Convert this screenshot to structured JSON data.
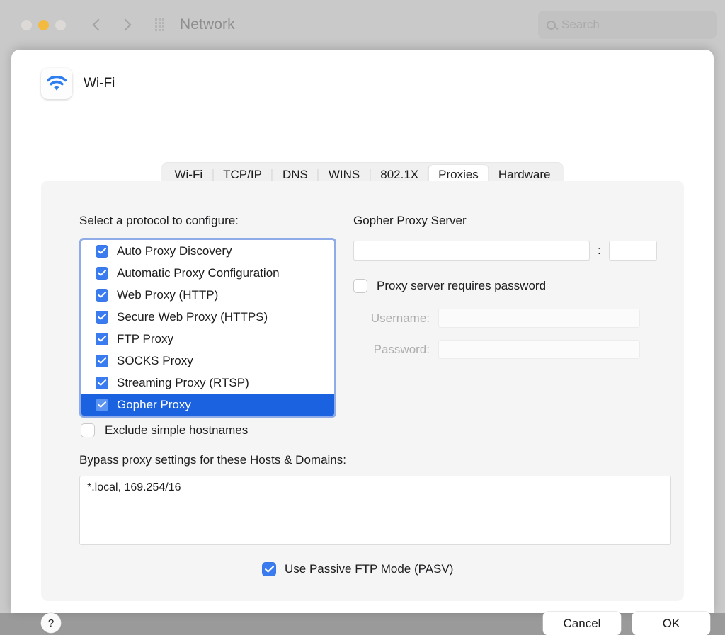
{
  "window": {
    "title": "Network",
    "search_placeholder": "Search",
    "traffic_lights": [
      "close",
      "minimize",
      "zoom"
    ]
  },
  "sheet": {
    "service_name": "Wi-Fi",
    "service_icon": "wifi-icon",
    "tabs": [
      {
        "label": "Wi-Fi",
        "selected": false
      },
      {
        "label": "TCP/IP",
        "selected": false
      },
      {
        "label": "DNS",
        "selected": false
      },
      {
        "label": "WINS",
        "selected": false
      },
      {
        "label": "802.1X",
        "selected": false
      },
      {
        "label": "Proxies",
        "selected": true
      },
      {
        "label": "Hardware",
        "selected": false
      }
    ],
    "protocol_section": {
      "label": "Select a protocol to configure:",
      "items": [
        {
          "label": "Auto Proxy Discovery",
          "checked": true,
          "selected": false
        },
        {
          "label": "Automatic Proxy Configuration",
          "checked": true,
          "selected": false
        },
        {
          "label": "Web Proxy (HTTP)",
          "checked": true,
          "selected": false
        },
        {
          "label": "Secure Web Proxy (HTTPS)",
          "checked": true,
          "selected": false
        },
        {
          "label": "FTP Proxy",
          "checked": true,
          "selected": false
        },
        {
          "label": "SOCKS Proxy",
          "checked": true,
          "selected": false
        },
        {
          "label": "Streaming Proxy (RTSP)",
          "checked": true,
          "selected": false
        },
        {
          "label": "Gopher Proxy",
          "checked": true,
          "selected": true
        }
      ]
    },
    "server_section": {
      "title": "Gopher Proxy Server",
      "host_value": "",
      "port_value": "",
      "separator": ":",
      "requires_password_label": "Proxy server requires password",
      "requires_password_checked": false,
      "username_label": "Username:",
      "username_value": "",
      "password_label": "Password:",
      "password_value": ""
    },
    "exclude_simple_hostnames": {
      "label": "Exclude simple hostnames",
      "checked": false
    },
    "bypass": {
      "label": "Bypass proxy settings for these Hosts & Domains:",
      "value": "*.local, 169.254/16"
    },
    "passive_ftp": {
      "label": "Use Passive FTP Mode (PASV)",
      "checked": true
    },
    "footer": {
      "help_label": "?",
      "cancel_label": "Cancel",
      "ok_label": "OK"
    }
  },
  "colors": {
    "accent_blue": "#3a7bf0",
    "selection_blue": "#1a62e0",
    "focus_ring": "#8fabe8",
    "minimize_yellow": "#f2bb3f"
  }
}
